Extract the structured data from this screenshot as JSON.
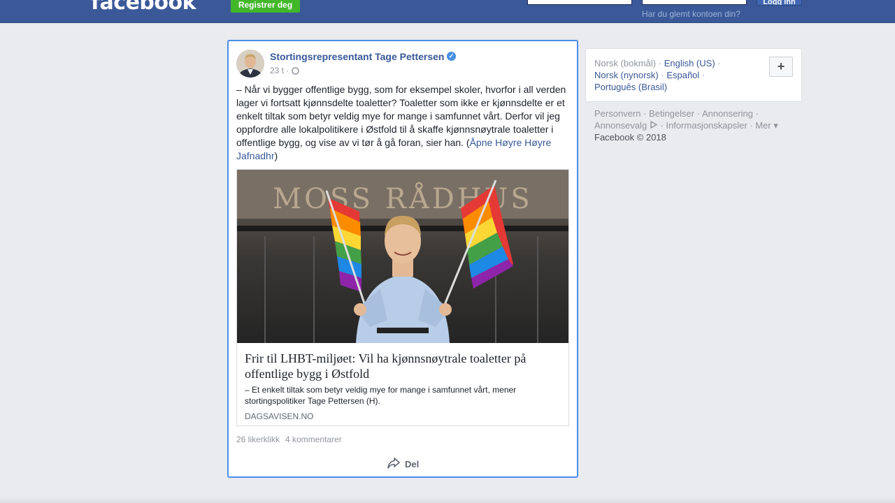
{
  "header": {
    "logo": "facebook",
    "register_label": "Registrer deg",
    "login_label": "Logg inn",
    "forgot_label": "Har du glemt kontoen din?"
  },
  "post": {
    "author": "Stortingsrepresentant Tage Pettersen",
    "time": "23 t ·",
    "text": "– Når vi bygger offentlige bygg, som for eksempel skoler, hvorfor i all verden lager vi fortsatt kjønnsdelte toaletter? Toaletter som ikke er kjønnsdelte er et enkelt tiltak som betyr veldig mye for mange i samfunnet vårt. Derfor vil jeg oppfordre alle lokalpolitikere i Østfold til å skaffe kjønnsnøytrale toaletter i offentlige bygg, og vise av vi tør å gå foran, sier han. (",
    "tag": "Åpne Høyre Høyre Jafnadhr",
    "text_end": ")",
    "preview": {
      "sign_text": "MOSS RÅDHUS",
      "title": "Frir til LHBT-miljøet: Vil ha kjønnsnøytrale toaletter på offentlige bygg i Østfold",
      "description": "– Et enkelt tiltak som betyr veldig mye for mange i samfunnet vårt, mener stortingspolitiker Tage Pettersen (H).",
      "domain": "DAGSAVISEN.NO"
    },
    "likes": "26 likerklikk",
    "comments": "4 kommentarer",
    "share_label": "Del"
  },
  "sidebar": {
    "lang_current": "Norsk (bokmål)",
    "lang_english": "English (US)",
    "lang_nynorsk": "Norsk (nynorsk)",
    "lang_spanish": "Español",
    "lang_portuguese": "Português (Brasil)",
    "add_label": "+",
    "footer": {
      "privacy": "Personvern",
      "terms": "Betingelser",
      "ads": "Annonsering",
      "ad_choices": "Annonsevalg",
      "cookies": "Informasjonskapsler",
      "more": "Mer",
      "copyright": "Facebook © 2018"
    }
  },
  "colors": {
    "header_bg": "#3b5998",
    "link": "#385898",
    "register_green": "#42b72a",
    "selected_border": "#4a8ded"
  }
}
